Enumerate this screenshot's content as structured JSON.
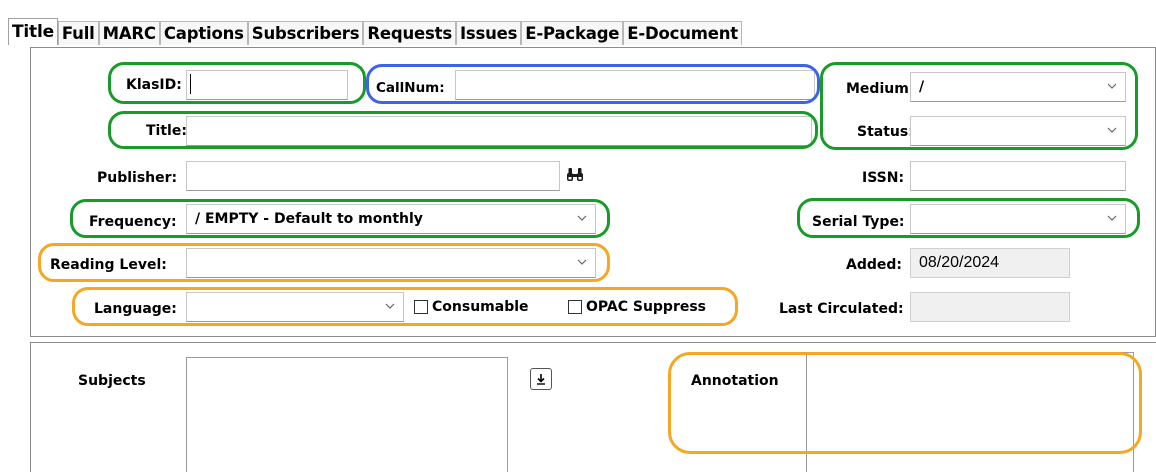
{
  "tabs": [
    "Title",
    "Full",
    "MARC",
    "Captions",
    "Subscribers",
    "Requests",
    "Issues",
    "E-Package",
    "E-Document"
  ],
  "fields": {
    "klasid_label": "KlasID:",
    "callnum_label": "CallNum:",
    "title_label": "Title:",
    "publisher_label": "Publisher:",
    "frequency_label": "Frequency:",
    "frequency_value": "/ EMPTY - Default to monthly",
    "reading_level_label": "Reading Level:",
    "language_label": "Language:",
    "consumable_label": "Consumable",
    "opac_suppress_label": "OPAC Suppress",
    "medium_label": "Medium:",
    "medium_value": "/",
    "status_label": "Status:",
    "issn_label": "ISSN:",
    "serial_type_label": "Serial Type:",
    "added_label": "Added:",
    "added_value": "08/20/2024",
    "last_circulated_label": "Last Circulated:"
  },
  "bottom": {
    "subjects_label": "Subjects",
    "annotation_label": "Annotation"
  },
  "colors": {
    "highlight_green": "#1a9a28",
    "highlight_blue": "#3d63e8",
    "highlight_orange": "#f5a623"
  },
  "icons": [
    "binoculars-icon",
    "download-arrow-icon",
    "chevron-down-icon"
  ]
}
